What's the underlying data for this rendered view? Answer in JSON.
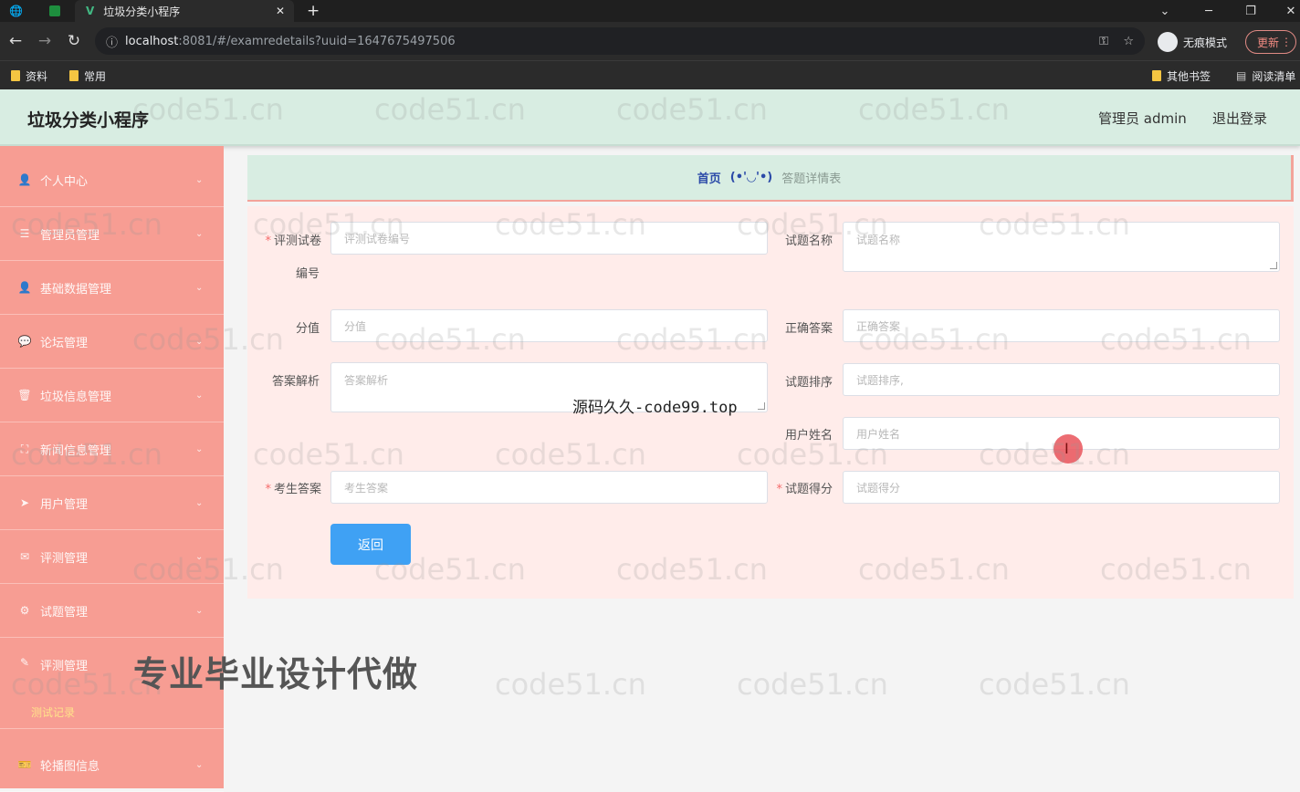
{
  "browser": {
    "tab_title": "垃圾分类小程序",
    "url_host": "localhost",
    "url_rest": ":8081/#/examredetails?uuid=1647675497506",
    "incognito_label": "无痕模式",
    "update_label": "更新",
    "bookmarks": [
      "资料",
      "常用"
    ],
    "bookmarks_right": [
      "其他书签",
      "阅读清单"
    ]
  },
  "header": {
    "title": "垃圾分类小程序",
    "admin": "管理员 admin",
    "logout": "退出登录"
  },
  "sidebar": {
    "items": [
      {
        "label": "个人中心",
        "icon": "user-icon"
      },
      {
        "label": "管理员管理",
        "icon": "list-icon"
      },
      {
        "label": "基础数据管理",
        "icon": "user-icon"
      },
      {
        "label": "论坛管理",
        "icon": "chat-icon"
      },
      {
        "label": "垃圾信息管理",
        "icon": "trash-icon"
      },
      {
        "label": "新闻信息管理",
        "icon": "news-icon"
      },
      {
        "label": "用户管理",
        "icon": "send-icon"
      },
      {
        "label": "评测管理",
        "icon": "mail-icon"
      },
      {
        "label": "试题管理",
        "icon": "gear-icon"
      },
      {
        "label": "评测管理",
        "icon": "pen-icon"
      },
      {
        "label": "轮播图信息",
        "icon": "ticket-icon"
      }
    ],
    "sub_label": "测试记录"
  },
  "breadcrumb": {
    "home": "首页",
    "separator": "(•'◡'•)",
    "current": "答题详情表"
  },
  "form": {
    "exam_paper_label_1": "评测试卷",
    "exam_paper_label_2": "编号",
    "exam_paper_placeholder": "评测试卷编号",
    "question_name_label": "试题名称",
    "question_name_placeholder": "试题名称",
    "score_label": "分值",
    "score_placeholder": "分值",
    "correct_answer_label": "正确答案",
    "correct_answer_placeholder": "正确答案",
    "analysis_label": "答案解析",
    "analysis_placeholder": "答案解析",
    "order_label": "试题排序",
    "order_placeholder": "试题排序,",
    "username_label": "用户姓名",
    "username_placeholder": "用户姓名",
    "student_answer_label": "考生答案",
    "student_answer_placeholder": "考生答案",
    "question_score_label": "试题得分",
    "question_score_placeholder": "试题得分",
    "back_button": "返回"
  },
  "overlays": {
    "watermark": "code51.cn",
    "caption_top": "源码久久-code99.top",
    "caption_big": "专业毕业设计代做"
  },
  "colors": {
    "sidebar": "#f79d93",
    "header": "#d8ede2",
    "button": "#3fa1f4",
    "form_bg": "#ffecea"
  }
}
